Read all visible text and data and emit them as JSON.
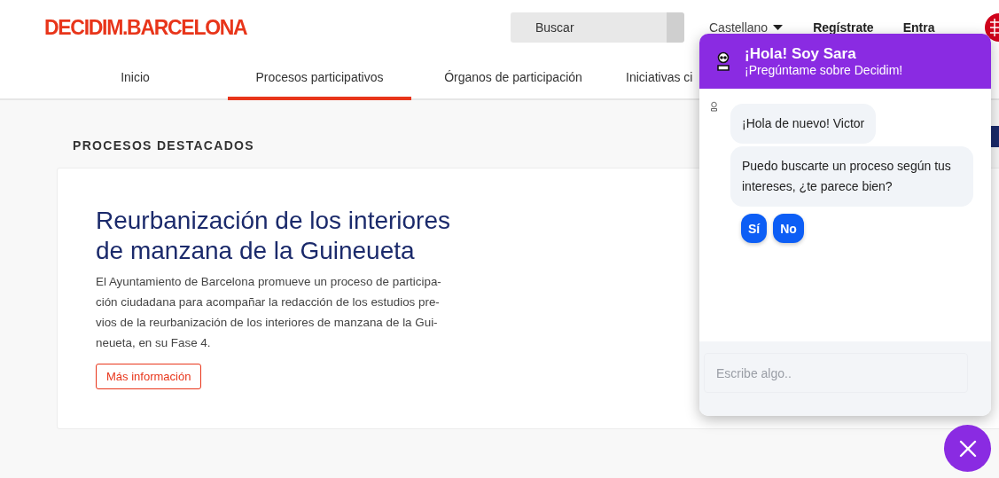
{
  "header": {
    "logo": "DECIDIM.BARCELONA",
    "search": {
      "placeholder": "Buscar"
    },
    "language": "Castellano",
    "links": [
      "Regístrate",
      "Entra"
    ]
  },
  "nav": [
    {
      "label": "Inicio",
      "selected": false
    },
    {
      "label": "Procesos participativos",
      "selected": true
    },
    {
      "label": "Órganos de participación",
      "selected": false
    },
    {
      "label": "Iniciativas ci",
      "selected": false
    }
  ],
  "section_title": "PROCESOS DESTACADOS",
  "featured": {
    "title": "Reurbanización de los interiores de manzana de la Guineueta",
    "description": "El Ayuntamiento de Barcelona promueve un proceso de participa-\nción ciudadana para acompañar la redacción de los estudios pre-\nvios de la reurbanización de los interiores de manzana de la Gui-\nneueta, en su Fase 4.",
    "button": "Más información"
  },
  "chat": {
    "title": "¡Hola! Soy Sara",
    "subtitle": "¡Pregúntame sobre Decidim!",
    "messages": [
      "¡Hola de nuevo! Victor",
      "Puedo buscarte un proceso según tus intereses, ¿te parece bien?"
    ],
    "replies": [
      "Sí",
      "No"
    ],
    "input": {
      "placeholder": "Escribe algo.."
    }
  }
}
